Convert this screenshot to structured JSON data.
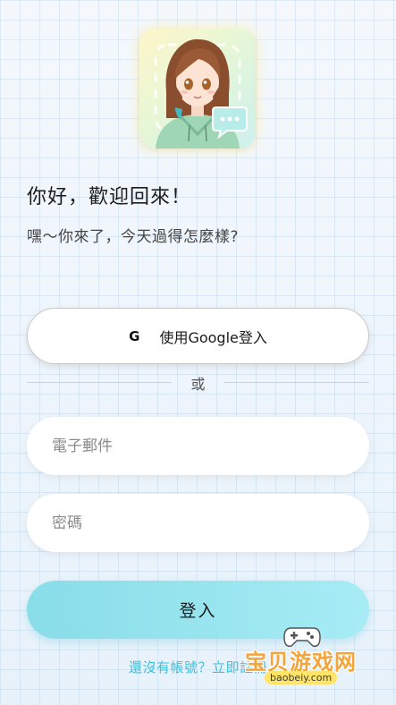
{
  "header": {
    "title": "你好，歡迎回來！",
    "subtitle": "嘿～你來了，今天過得怎麼樣?"
  },
  "avatar": {
    "icon": "chat-bubble-icon"
  },
  "google_button": {
    "icon_text": "G",
    "label": "使用Google登入"
  },
  "divider": {
    "label": "或"
  },
  "form": {
    "email_placeholder": "電子郵件",
    "password_placeholder": "密碼",
    "login_label": "登入"
  },
  "signup": {
    "label": "還沒有帳號？立即註冊"
  },
  "watermark": {
    "brand": "宝贝游戏网",
    "url": "baobeiy.com"
  },
  "colors": {
    "accent": "#88dde8",
    "link": "#3cc0d8",
    "background": "#eef5fb"
  }
}
